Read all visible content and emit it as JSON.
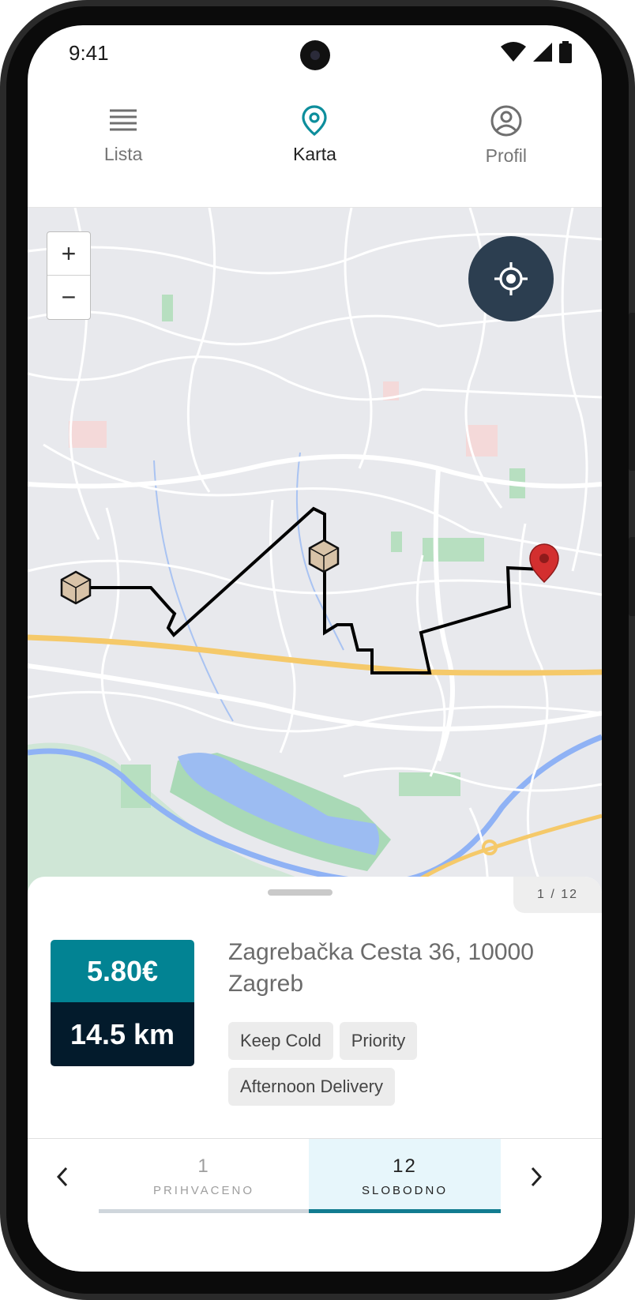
{
  "status_bar": {
    "time": "9:41"
  },
  "tabs": [
    {
      "label": "Lista",
      "icon": "list-icon",
      "active": false
    },
    {
      "label": "Karta",
      "icon": "map-pin-icon",
      "active": true
    },
    {
      "label": "Profil",
      "icon": "user-circle-icon",
      "active": false
    }
  ],
  "map": {
    "zoom_in": "+",
    "zoom_out": "−",
    "locate_icon": "crosshair-icon",
    "route_color": "#000000",
    "destination_color": "#d32f2f"
  },
  "sheet": {
    "counter": "1 / 12",
    "price": "5.80€",
    "distance": "14.5 km",
    "address": "Zagrebačka Cesta 36, 10000 Zagreb",
    "tags": [
      "Keep Cold",
      "Priority",
      "Afternoon Delivery"
    ]
  },
  "bottom_nav": {
    "segments": [
      {
        "count": "1",
        "label": "PRIHVACENO",
        "active": false
      },
      {
        "count": "12",
        "label": "SLOBODNO",
        "active": true
      }
    ],
    "accent": "#127c90"
  }
}
